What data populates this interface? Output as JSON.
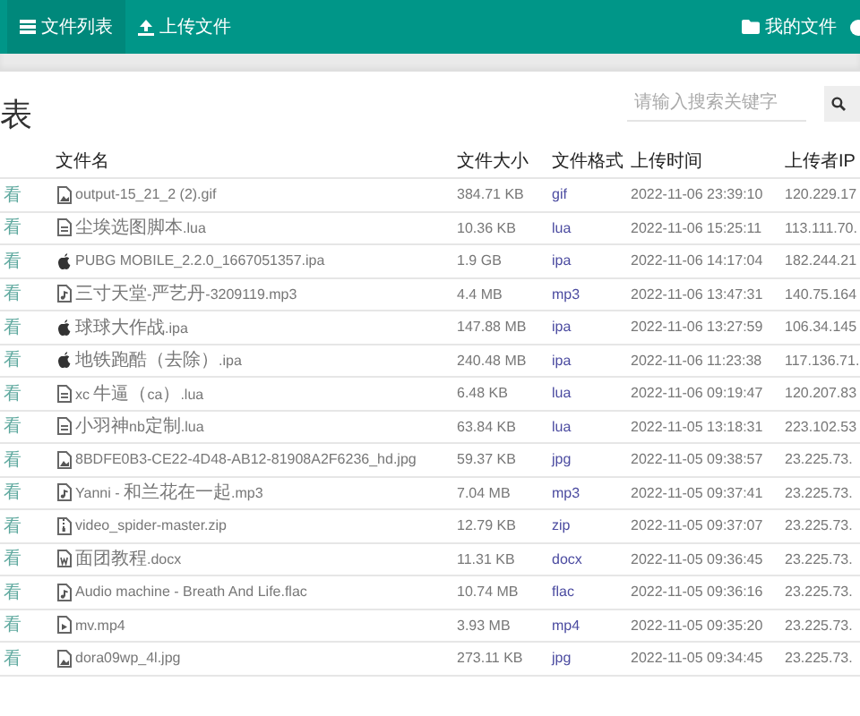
{
  "navbar": {
    "items": [
      {
        "label": "文件列表",
        "kind": "list",
        "selected": true
      },
      {
        "label": "上传文件",
        "kind": "upload",
        "selected": false
      }
    ],
    "right_items": [
      {
        "label": "我的文件",
        "kind": "folder"
      }
    ]
  },
  "header": {
    "title": "表",
    "search": {
      "placeholder": "请输入搜索关键字"
    }
  },
  "table": {
    "columns": [
      "文件名",
      "文件大小",
      "文件格式",
      "上传时间",
      "上传者IP"
    ],
    "rows": [
      {
        "action": "看",
        "kind": "image",
        "name": "output-15_21_2 (2).gif",
        "size": "384.71 KB",
        "format": "gif",
        "time": "2022-11-06 23:39:10",
        "ip": "120.229.17"
      },
      {
        "action": "看",
        "kind": "file",
        "name": "尘埃选图脚本.lua",
        "size": "10.36 KB",
        "format": "lua",
        "time": "2022-11-06 15:25:11",
        "ip": "113.111.70."
      },
      {
        "action": "看",
        "kind": "apple",
        "name": "PUBG MOBILE_2.2.0_1667051357.ipa",
        "size": "1.9 GB",
        "format": "ipa",
        "time": "2022-11-06 14:17:04",
        "ip": "182.244.21"
      },
      {
        "action": "看",
        "kind": "audio",
        "name": "三寸天堂-严艺丹-3209119.mp3",
        "size": "4.4 MB",
        "format": "mp3",
        "time": "2022-11-06 13:47:31",
        "ip": "140.75.164"
      },
      {
        "action": "看",
        "kind": "apple",
        "name": "球球大作战.ipa",
        "size": "147.88 MB",
        "format": "ipa",
        "time": "2022-11-06 13:27:59",
        "ip": "106.34.145"
      },
      {
        "action": "看",
        "kind": "apple",
        "name": "地铁跑酷（去除）.ipa",
        "size": "240.48 MB",
        "format": "ipa",
        "time": "2022-11-06 11:23:38",
        "ip": "117.136.71."
      },
      {
        "action": "看",
        "kind": "file",
        "name": "xc 牛逼（ca）.lua",
        "size": "6.48 KB",
        "format": "lua",
        "time": "2022-11-06 09:19:47",
        "ip": "120.207.83"
      },
      {
        "action": "看",
        "kind": "file",
        "name": "小羽神nb定制.lua",
        "size": "63.84 KB",
        "format": "lua",
        "time": "2022-11-05 13:18:31",
        "ip": "223.102.53"
      },
      {
        "action": "看",
        "kind": "image",
        "name": "8BDFE0B3-CE22-4D48-AB12-81908A2F6236_hd.jpg",
        "size": "59.37 KB",
        "format": "jpg",
        "time": "2022-11-05 09:38:57",
        "ip": "23.225.73."
      },
      {
        "action": "看",
        "kind": "audio",
        "name": "Yanni - 和兰花在一起.mp3",
        "size": "7.04 MB",
        "format": "mp3",
        "time": "2022-11-05 09:37:41",
        "ip": "23.225.73."
      },
      {
        "action": "看",
        "kind": "archive",
        "name": "video_spider-master.zip",
        "size": "12.79 KB",
        "format": "zip",
        "time": "2022-11-05 09:37:07",
        "ip": "23.225.73."
      },
      {
        "action": "看",
        "kind": "word",
        "name": "面团教程.docx",
        "size": "11.31 KB",
        "format": "docx",
        "time": "2022-11-05 09:36:45",
        "ip": "23.225.73."
      },
      {
        "action": "看",
        "kind": "audio",
        "name": "Audio machine - Breath And Life.flac",
        "size": "10.74 MB",
        "format": "flac",
        "time": "2022-11-05 09:36:16",
        "ip": "23.225.73."
      },
      {
        "action": "看",
        "kind": "video",
        "name": "mv.mp4",
        "size": "3.93 MB",
        "format": "mp4",
        "time": "2022-11-05 09:35:20",
        "ip": "23.225.73."
      },
      {
        "action": "看",
        "kind": "image",
        "name": "dora09wp_4l.jpg",
        "size": "273.11 KB",
        "format": "jpg",
        "time": "2022-11-05 09:34:45",
        "ip": "23.225.73."
      }
    ]
  }
}
